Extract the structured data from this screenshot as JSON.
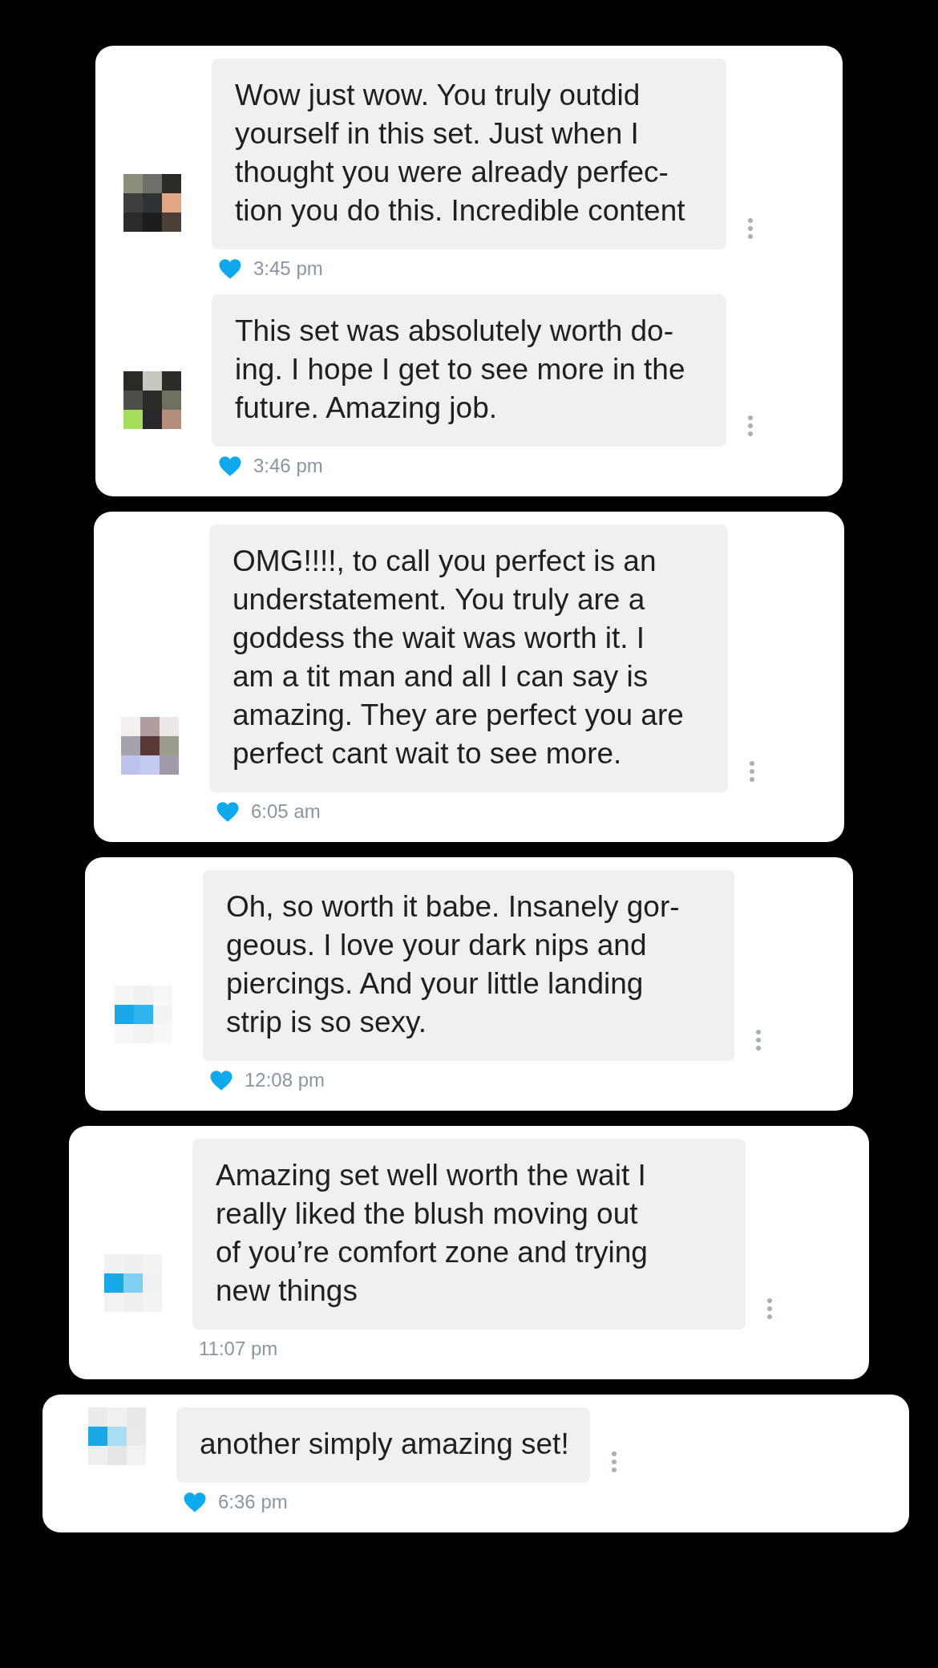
{
  "cards": [
    {
      "messages": [
        {
          "text": "Wow just wow. You truly outdid\nyourself in this set. Just when I\nthought you were already perfec-\ntion you do this. Incredible content",
          "time": "3:45 pm",
          "liked": true
        },
        {
          "text": "This set was absolutely worth do-\ning. I hope I get to see more in the\nfuture. Amazing job.",
          "time": "3:46 pm",
          "liked": true
        }
      ]
    },
    {
      "messages": [
        {
          "text": "OMG!!!!, to call you perfect is an\nunderstatement. You truly are a\ngoddess the wait was worth it. I\nam a tit man and all I can say is\namazing. They are perfect you are\nperfect cant wait to see more.",
          "time": "6:05 am",
          "liked": true
        }
      ]
    },
    {
      "messages": [
        {
          "text": "Oh, so worth it babe. Insanely gor-\ngeous. I love your dark nips and\npiercings. And your little landing\nstrip is so sexy.",
          "time": "12:08 pm",
          "liked": true
        }
      ]
    },
    {
      "messages": [
        {
          "text": "Amazing set well worth the wait I\nreally liked the blush moving out\nof you’re comfort zone and trying\nnew things",
          "time": "11:07 pm",
          "liked": false
        }
      ]
    },
    {
      "messages": [
        {
          "text": "another simply amazing set!",
          "time": "6:36 pm",
          "liked": true
        }
      ]
    }
  ]
}
